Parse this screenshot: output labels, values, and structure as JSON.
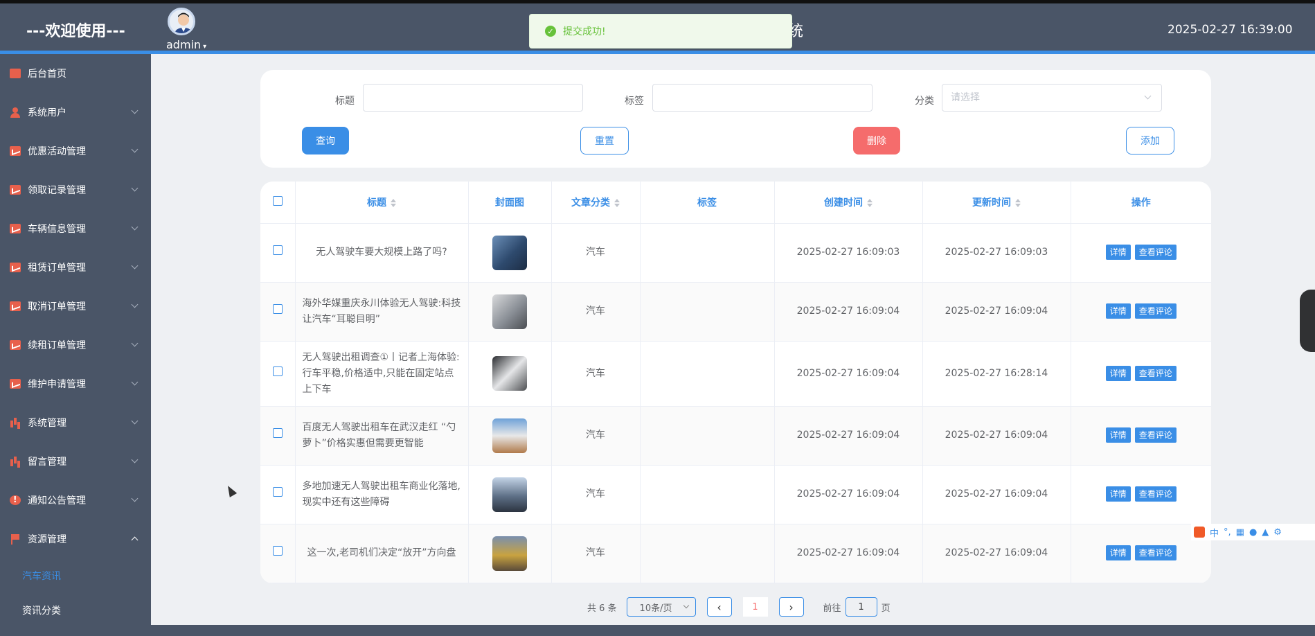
{
  "header": {
    "welcome": "---欢迎使用---",
    "user": "admin",
    "title_fragment": "统",
    "datetime": "2025-02-27 16:39:00"
  },
  "toast": {
    "message": "提交成功!"
  },
  "sidebar": {
    "items": [
      {
        "label": "后台首页",
        "icon": "monitor-icon"
      },
      {
        "label": "系统用户",
        "icon": "user-icon"
      },
      {
        "label": "优惠活动管理",
        "icon": "chart-icon"
      },
      {
        "label": "领取记录管理",
        "icon": "chart-icon"
      },
      {
        "label": "车辆信息管理",
        "icon": "chart-icon"
      },
      {
        "label": "租赁订单管理",
        "icon": "chart-icon"
      },
      {
        "label": "取消订单管理",
        "icon": "chart-icon"
      },
      {
        "label": "续租订单管理",
        "icon": "chart-icon"
      },
      {
        "label": "维护申请管理",
        "icon": "chart-icon"
      },
      {
        "label": "系统管理",
        "icon": "bars-icon"
      },
      {
        "label": "留言管理",
        "icon": "bars-icon"
      },
      {
        "label": "通知公告管理",
        "icon": "info-icon"
      },
      {
        "label": "资源管理",
        "icon": "flag-icon"
      }
    ],
    "sub_items": [
      "汽车资讯",
      "资讯分类"
    ]
  },
  "search": {
    "title_label": "标题",
    "tag_label": "标签",
    "category_label": "分类",
    "category_placeholder": "请选择",
    "query": "查询",
    "reset": "重置",
    "delete": "删除",
    "add": "添加"
  },
  "table": {
    "columns": [
      "标题",
      "封面图",
      "文章分类",
      "标签",
      "创建时间",
      "更新时间",
      "操作"
    ],
    "action_detail": "详情",
    "action_comments": "查看评论",
    "rows": [
      {
        "title": "无人驾驶车要大规模上路了吗?",
        "category": "汽车",
        "tag": "",
        "created": "2025-02-27 16:09:03",
        "updated": "2025-02-27 16:09:03",
        "thumb": "#2e4a6e"
      },
      {
        "title": "海外华媒重庆永川体验无人驾驶:科技让汽车“耳聪目明”",
        "category": "汽车",
        "tag": "",
        "created": "2025-02-27 16:09:04",
        "updated": "2025-02-27 16:09:04",
        "thumb": "#8a8f96"
      },
      {
        "title": "无人驾驶出租调查①丨记者上海体验:行车平稳,价格适中,只能在固定站点上下车",
        "category": "汽车",
        "tag": "",
        "created": "2025-02-27 16:09:04",
        "updated": "2025-02-27 16:28:14",
        "thumb": "#4d4f52"
      },
      {
        "title": "百度无人驾驶出租车在武汉走红 “勺萝卜”价格实惠但需要更智能",
        "category": "汽车",
        "tag": "",
        "created": "2025-02-27 16:09:04",
        "updated": "2025-02-27 16:09:04",
        "thumb": "#b07a4a"
      },
      {
        "title": "多地加速无人驾驶出租车商业化落地,现实中还有这些障碍",
        "category": "汽车",
        "tag": "",
        "created": "2025-02-27 16:09:04",
        "updated": "2025-02-27 16:09:04",
        "thumb": "#5d6f86"
      },
      {
        "title": "这一次,老司机们决定“放开”方向盘",
        "category": "汽车",
        "tag": "",
        "created": "2025-02-27 16:09:04",
        "updated": "2025-02-27 16:09:04",
        "thumb": "#c9a340"
      }
    ]
  },
  "pagination": {
    "total": "共 6 条",
    "page_size": "10条/页",
    "current": "1",
    "goto_prefix": "前往",
    "goto_value": "1",
    "goto_suffix": "页"
  },
  "ime": {
    "text": "中"
  }
}
